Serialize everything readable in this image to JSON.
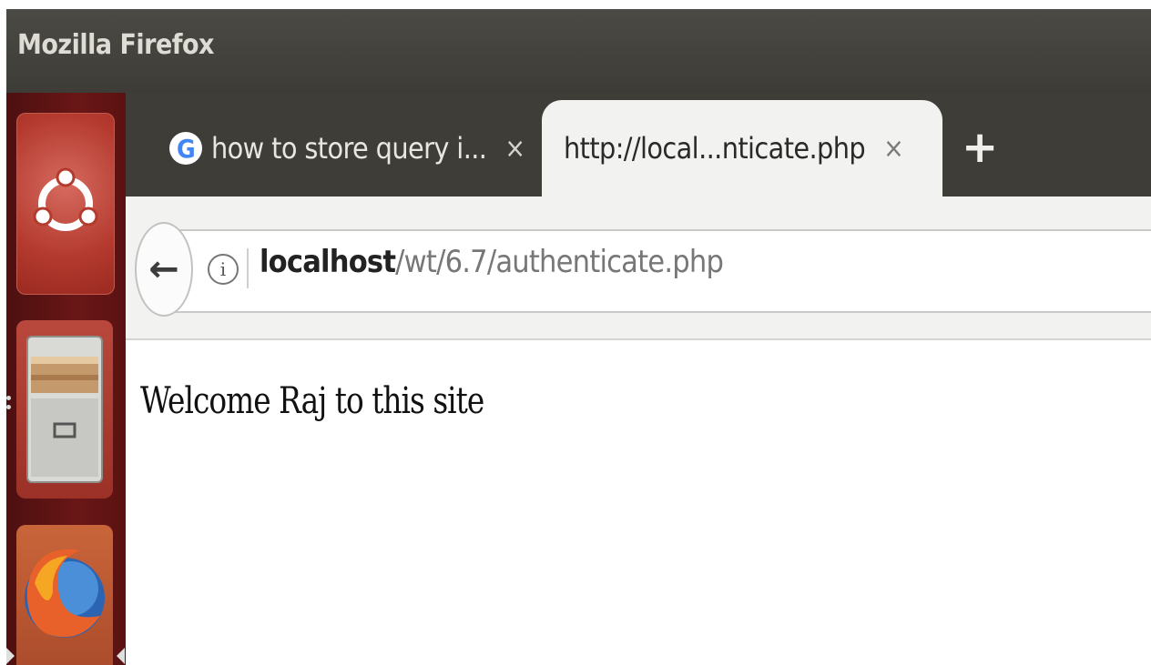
{
  "window": {
    "title": "Mozilla Firefox"
  },
  "launcher": {
    "items": [
      {
        "name": "ubuntu-dash"
      },
      {
        "name": "files"
      },
      {
        "name": "firefox"
      }
    ]
  },
  "tabs": [
    {
      "label": "how to store query i...",
      "close": "×",
      "favicon": "G",
      "active": false
    },
    {
      "label": "http://local...nticate.php",
      "close": "×",
      "active": true
    }
  ],
  "new_tab": "+",
  "navbar": {
    "back": "←",
    "info": "i",
    "url_host": "localhost",
    "url_path": "/wt/6.7/authenticate.php"
  },
  "page": {
    "message": "Welcome Raj to this site"
  },
  "colors": {
    "titlebar": "#3d3c37",
    "launcher": "#6a1616",
    "accent_google_blue": "#4285f4"
  }
}
